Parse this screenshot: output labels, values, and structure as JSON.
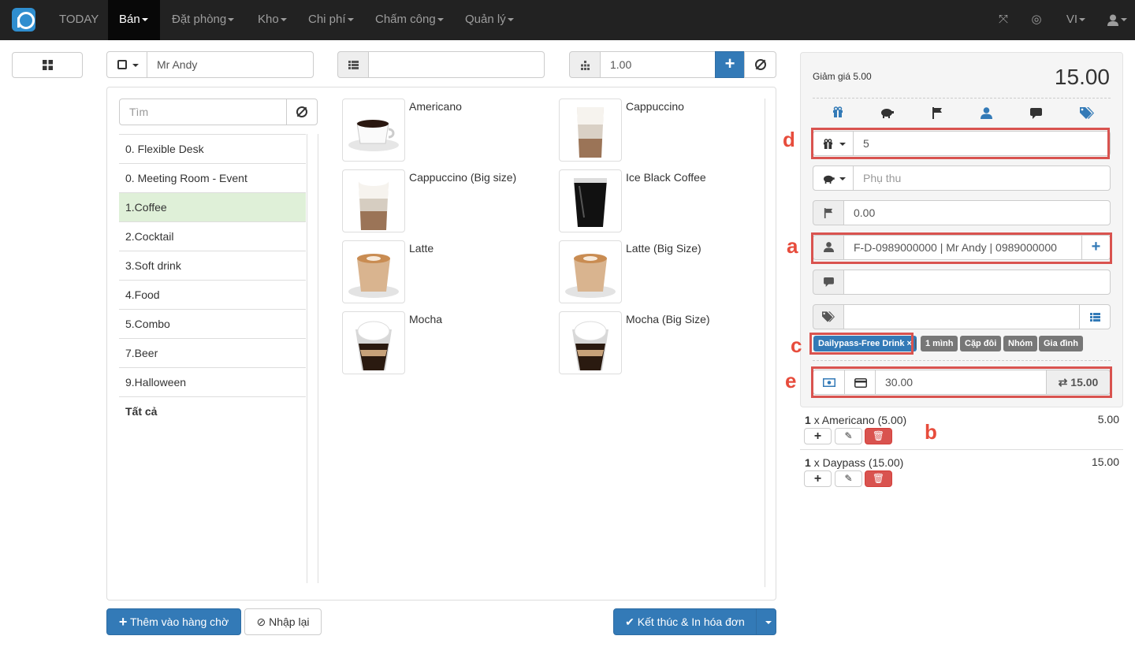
{
  "nav": {
    "items": [
      {
        "label": "TODAY",
        "dropdown": false
      },
      {
        "label": "Bán",
        "dropdown": true
      },
      {
        "label": "Đặt phòng",
        "dropdown": true
      },
      {
        "label": "Kho",
        "dropdown": true
      },
      {
        "label": "Chi phí",
        "dropdown": true
      },
      {
        "label": "Chấm công",
        "dropdown": true
      },
      {
        "label": "Quản lý",
        "dropdown": true
      }
    ],
    "lang": "VI",
    "accent": "#2f8ecf"
  },
  "toolbar": {
    "customer_value": "Mr Andy",
    "table_value": "",
    "qty_value": "1.00"
  },
  "sidebar": {
    "search_placeholder": "Tìm",
    "categories": [
      "0. Flexible Desk",
      "0. Meeting Room - Event",
      "1.Coffee",
      "2.Cocktail",
      "3.Soft drink",
      "4.Food",
      "5.Combo",
      "7.Beer",
      "9.Halloween",
      "Tất cả"
    ],
    "selected": "1.Coffee"
  },
  "products": [
    "Americano",
    "Cappuccino",
    "Cappuccino (Big size)",
    "Ice Black Coffee",
    "Latte",
    "Latte (Big Size)",
    "Mocha",
    "Mocha (Big Size)"
  ],
  "footer": {
    "queue_label": "Thêm vào hàng chờ",
    "reset_label": "Nhập lại",
    "finish_label": "Kết thúc & In hóa đơn"
  },
  "panel": {
    "discount_label": "Giảm giá 5.00",
    "total": "15.00",
    "discount_value": "5",
    "surcharge_placeholder": "Phụ thu",
    "flag_value": "0.00",
    "customer_value": "F-D-0989000000 | Mr Andy | 0989000000",
    "note_value": "",
    "tags_value": "",
    "selected_tag": "Dailypass-Free Drink ×",
    "tag_options": [
      "1 mình",
      "Cặp đôi",
      "Nhóm",
      "Gia đình"
    ],
    "separator": "|",
    "payment_value": "30.00",
    "change_value": "15.00"
  },
  "order": [
    {
      "qty": "1",
      "text": "x Americano (5.00)",
      "amount": "5.00"
    },
    {
      "qty": "1",
      "text": "x Daypass (15.00)",
      "amount": "15.00"
    }
  ],
  "annotations": {
    "a": "a",
    "b": "b",
    "c": "c",
    "d": "d",
    "e": "e"
  }
}
